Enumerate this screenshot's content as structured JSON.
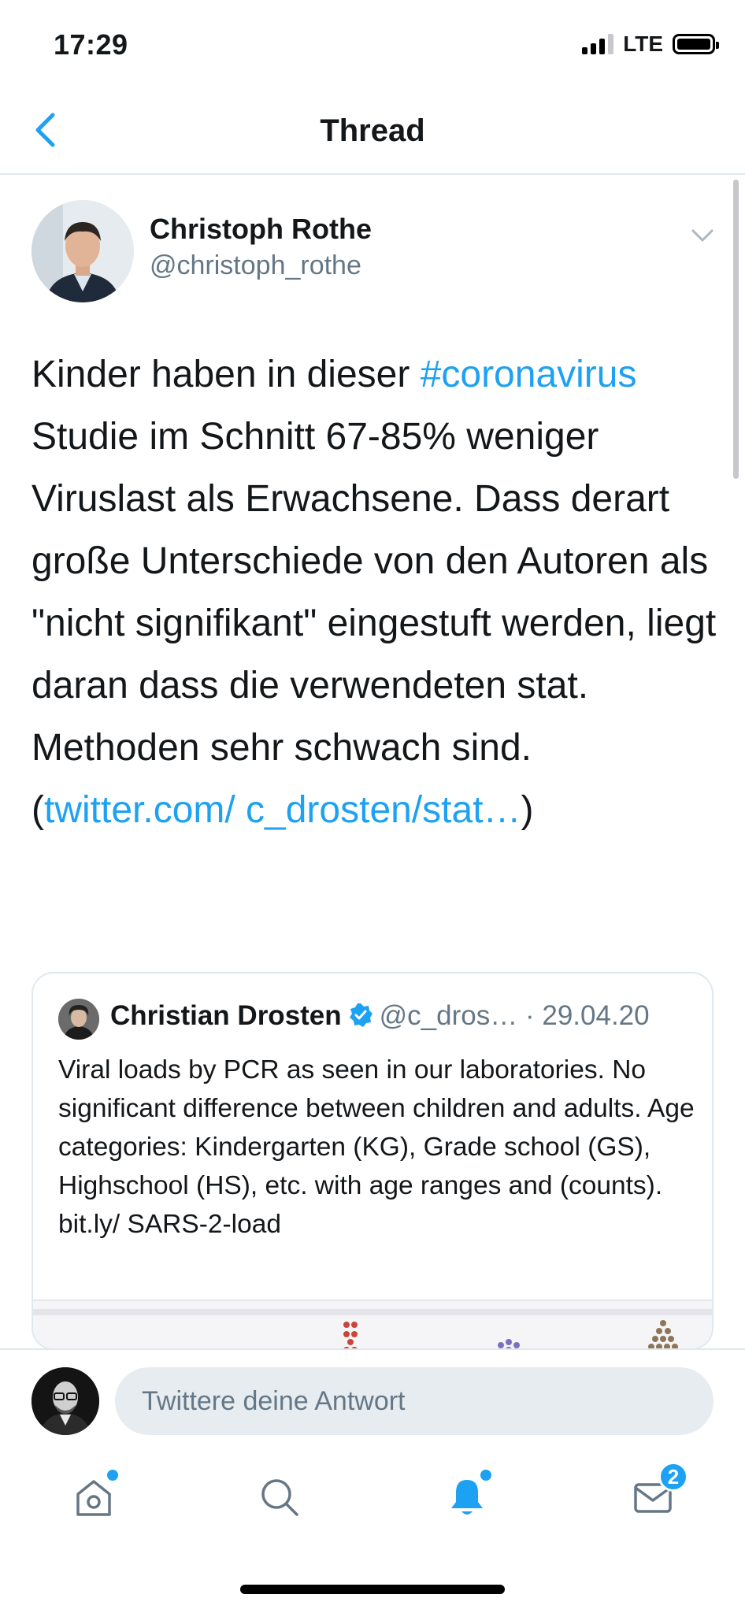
{
  "status_bar": {
    "time": "17:29",
    "network": "LTE"
  },
  "nav": {
    "title": "Thread",
    "back_icon": "chevron-left-icon"
  },
  "tweet": {
    "author_name": "Christoph Rothe",
    "author_handle": "@christoph_rothe",
    "text_part1": "Kinder haben in dieser ",
    "hashtag": "#coronavirus",
    "text_part2": " Studie im Schnitt 67-85% weniger Viruslast als Erwachsene.  Dass derart große Unterschiede von den Autoren als \"nicht signifikant\" eingestuft werden, liegt daran dass die verwendeten stat. Methoden sehr schwach sind. (",
    "link_text": "twitter.com/ c_drosten/stat…",
    "text_part3": ")"
  },
  "quoted_tweet": {
    "author_name": "Christian Drosten",
    "author_handle": "@c_dros…",
    "separator": " · ",
    "date": "29.04.20",
    "text": "Viral loads by PCR as seen in our laboratories. No significant difference between children and adults. Age categories: Kindergarten (KG), Grade school (GS), Highschool (HS), etc. with age ranges and (counts). bit.ly/ SARS-2-load"
  },
  "reply": {
    "placeholder": "Twittere deine Antwort"
  },
  "tab_bar": {
    "messages_badge": "2"
  },
  "colors": {
    "accent": "#1da1f2",
    "secondary_text": "#657786",
    "border": "#e1e8ed"
  }
}
